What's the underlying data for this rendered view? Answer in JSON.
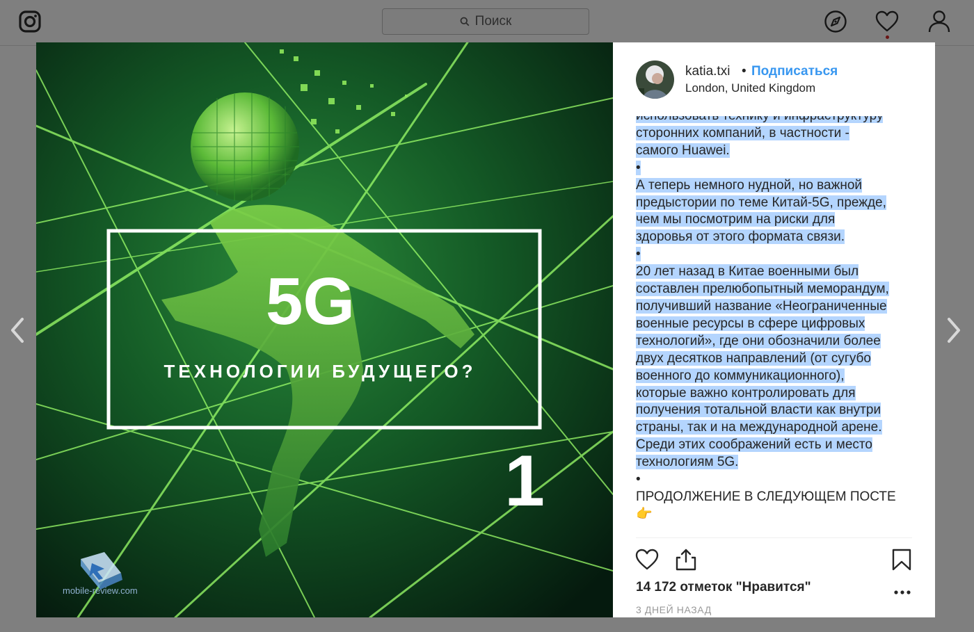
{
  "topbar": {
    "search_placeholder": "Поиск",
    "icons": [
      "instagram-logo-icon",
      "search-icon",
      "compass-icon",
      "heart-icon",
      "profile-icon"
    ]
  },
  "post": {
    "image": {
      "title": "5G",
      "subtitle": "ТЕХНОЛОГИИ БУДУЩЕГО?",
      "page_number": "1",
      "watermark": "mobile-review.com"
    },
    "author": {
      "username": "katia.txi",
      "separator": "•",
      "follow_label": "Подписаться",
      "location": "London, United Kingdom"
    },
    "caption_lines": [
      "использовать технику и инфраструктуру",
      "сторонних компаний, в частности -",
      "самого Huawei.",
      "•",
      "А теперь немного нудной, но важной",
      "предыстории по теме Китай-5G, прежде,",
      "чем мы посмотрим на риски для",
      "здоровья от этого формата связи.",
      "•",
      "20 лет назад в Китае военными был",
      "составлен прелюбопытный меморандум,",
      "получивший название «Неограниченные",
      "военные ресурсы в сфере цифровых",
      "технологий», где они обозначили более",
      "двух десятков направлений (от сугубо",
      "военного до коммуникационного),",
      "которые важно контролировать для",
      "получения тотальной власти как внутри",
      "страны, так и на международной арене.",
      "Среди этих соображений есть и место",
      "технологиям 5G.",
      "•",
      "ПРОДОЛЖЕНИЕ В СЛЕДУЮЩЕМ ПОСТЕ",
      "👉"
    ],
    "likes_text": "14 172 отметок \"Нравится\"",
    "date_text": "3 ДНЕЙ НАЗАД",
    "colors": {
      "follow": "#3897f0",
      "selection": "#b4d5fe",
      "text": "#262626",
      "muted": "#999999"
    }
  }
}
